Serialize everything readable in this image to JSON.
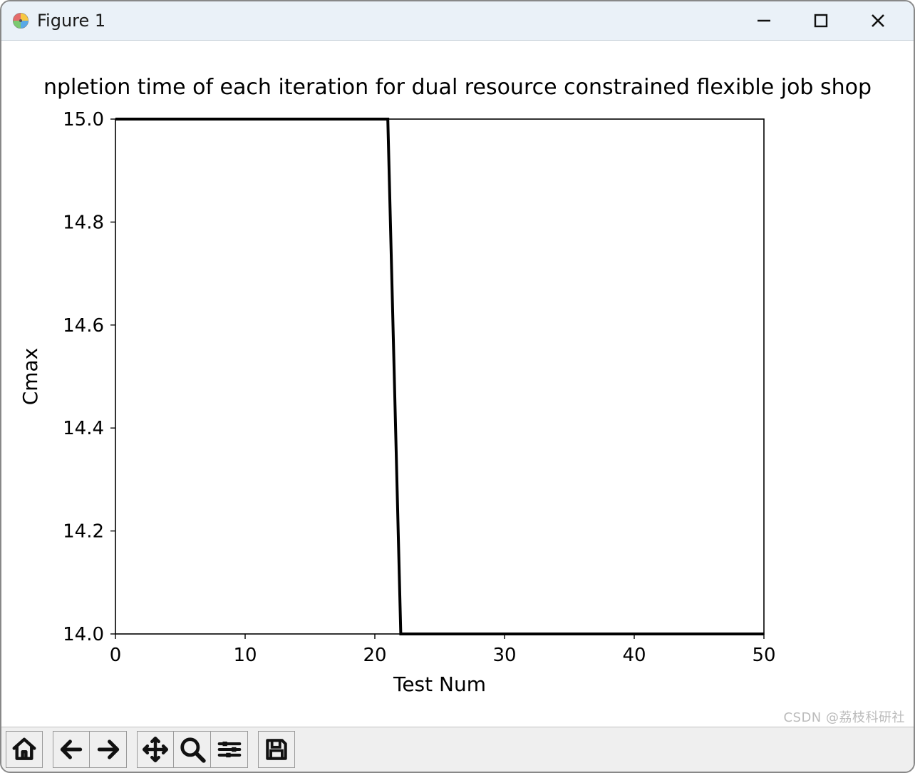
{
  "window": {
    "title": "Figure 1"
  },
  "toolbar": {
    "home": "Home",
    "back": "Back",
    "forward": "Forward",
    "pan": "Pan",
    "zoom": "Zoom",
    "configure": "Configure subplots",
    "save": "Save"
  },
  "watermark": "CSDN @荔枝科研社",
  "chart_data": {
    "type": "line",
    "title": "npletion time of each iteration for dual resource constrained flexible job shop",
    "xlabel": "Test Num",
    "ylabel": "Cmax",
    "xlim": [
      0,
      50
    ],
    "ylim": [
      14.0,
      15.0
    ],
    "xticks": [
      0,
      10,
      20,
      30,
      40,
      50
    ],
    "yticks": [
      14.0,
      14.2,
      14.4,
      14.6,
      14.8,
      15.0
    ],
    "series": [
      {
        "name": "Cmax",
        "x": [
          0,
          1,
          2,
          3,
          4,
          5,
          6,
          7,
          8,
          9,
          10,
          11,
          12,
          13,
          14,
          15,
          16,
          17,
          18,
          19,
          20,
          21,
          22,
          23,
          24,
          25,
          26,
          27,
          28,
          29,
          30,
          31,
          32,
          33,
          34,
          35,
          36,
          37,
          38,
          39,
          40,
          41,
          42,
          43,
          44,
          45,
          46,
          47,
          48,
          49,
          50
        ],
        "y": [
          15.0,
          15.0,
          15.0,
          15.0,
          15.0,
          15.0,
          15.0,
          15.0,
          15.0,
          15.0,
          15.0,
          15.0,
          15.0,
          15.0,
          15.0,
          15.0,
          15.0,
          15.0,
          15.0,
          15.0,
          15.0,
          15.0,
          14.0,
          14.0,
          14.0,
          14.0,
          14.0,
          14.0,
          14.0,
          14.0,
          14.0,
          14.0,
          14.0,
          14.0,
          14.0,
          14.0,
          14.0,
          14.0,
          14.0,
          14.0,
          14.0,
          14.0,
          14.0,
          14.0,
          14.0,
          14.0,
          14.0,
          14.0,
          14.0,
          14.0,
          14.0
        ]
      }
    ]
  }
}
